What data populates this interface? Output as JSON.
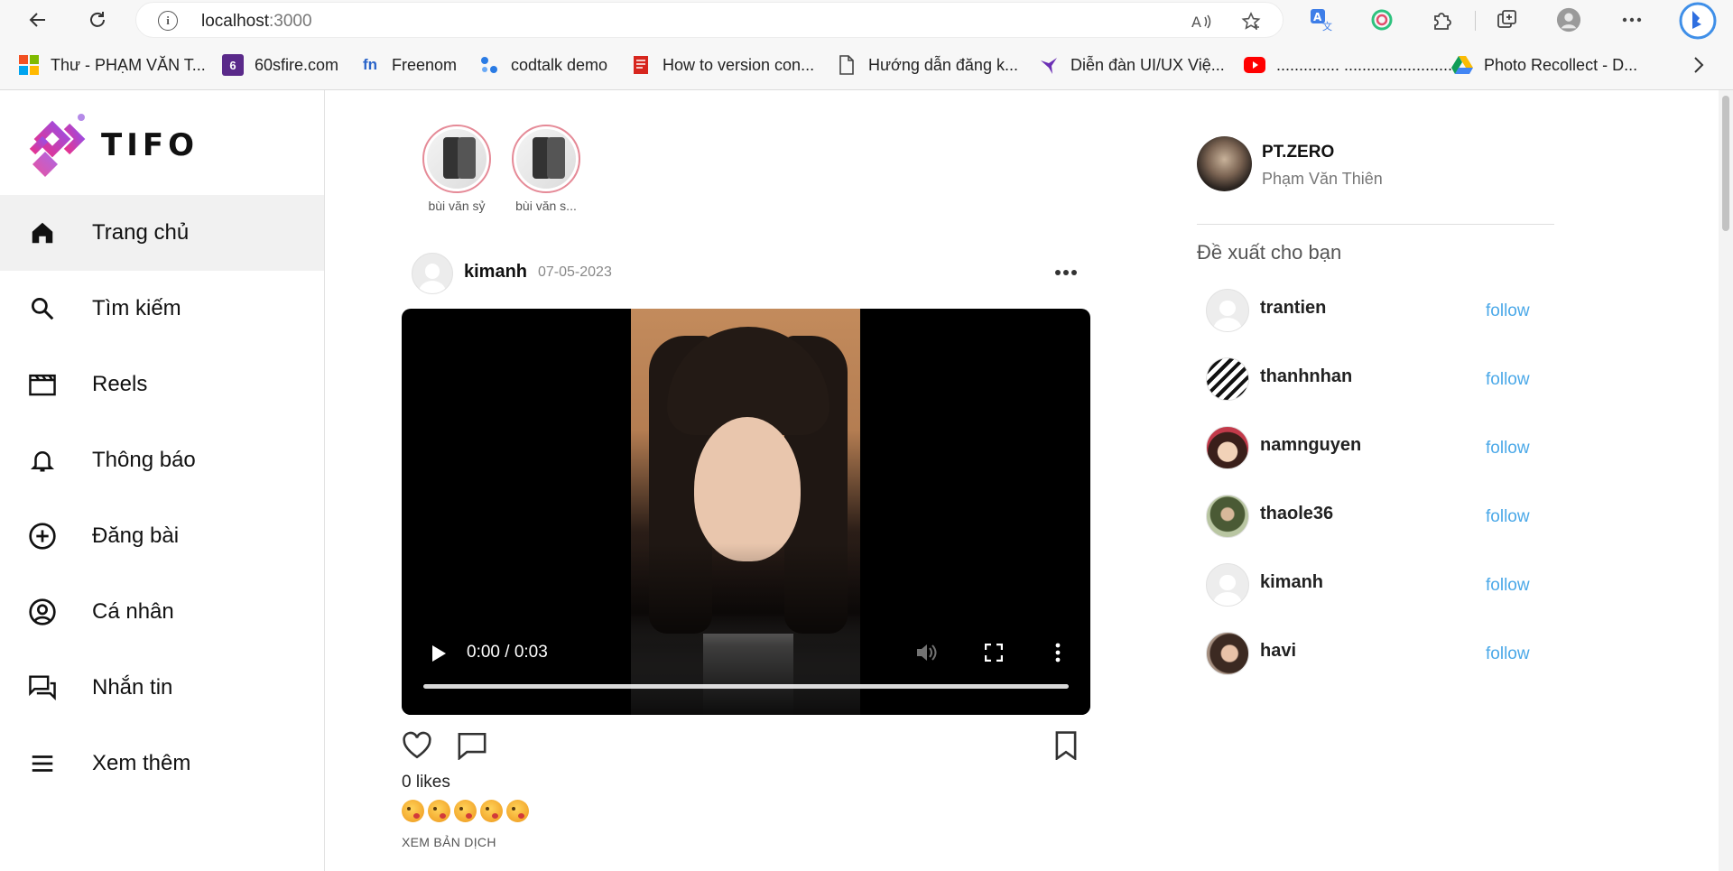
{
  "browser": {
    "url_host": "localhost",
    "url_port": ":3000",
    "bookmarks": [
      {
        "label": "Thư - PHẠM VĂN T...",
        "icon": "microsoft-icon"
      },
      {
        "label": "60sfire.com",
        "icon": "sixty-fire-icon"
      },
      {
        "label": "Freenom",
        "icon": "freenom-icon"
      },
      {
        "label": "codtalk demo",
        "icon": "codtalk-icon"
      },
      {
        "label": "How to version con...",
        "icon": "doc-red-icon"
      },
      {
        "label": "Hướng dẫn đăng k...",
        "icon": "page-icon"
      },
      {
        "label": "Diễn đàn UI/UX Việ...",
        "icon": "uiux-icon"
      },
      {
        "label": "..............  ............................",
        "icon": "youtube-icon"
      },
      {
        "label": "Photo Recollect - D...",
        "icon": "drive-icon"
      }
    ]
  },
  "sidebar": {
    "logo_text": "TIFO",
    "nav": [
      {
        "label": "Trang chủ",
        "icon": "home-icon",
        "active": true
      },
      {
        "label": "Tìm kiếm",
        "icon": "search-icon"
      },
      {
        "label": "Reels",
        "icon": "reels-icon"
      },
      {
        "label": "Thông báo",
        "icon": "bell-icon"
      },
      {
        "label": "Đăng bài",
        "icon": "add-circle-icon"
      },
      {
        "label": "Cá nhân",
        "icon": "profile-icon"
      },
      {
        "label": "Nhắn tin",
        "icon": "messages-icon"
      },
      {
        "label": "Xem thêm",
        "icon": "menu-icon"
      }
    ]
  },
  "stories": [
    {
      "name": "bùi văn sỷ"
    },
    {
      "name": "bùi văn s..."
    }
  ],
  "post": {
    "username": "kimanh",
    "date": "07-05-2023",
    "video": {
      "time": "0:00 / 0:03",
      "progress": 0
    },
    "likes": "0 likes",
    "emoji_count": 5,
    "translate": "XEM BẢN DỊCH"
  },
  "right_panel": {
    "me": {
      "username": "PT.ZERO",
      "full_name": "Phạm Văn Thiên"
    },
    "suggest_title": "Đề xuất cho bạn",
    "follow_label": "follow",
    "suggestions": [
      {
        "username": "trantien",
        "avatar": "placeholder"
      },
      {
        "username": "thanhnhan",
        "avatar": "manga"
      },
      {
        "username": "namnguyen",
        "avatar": "anime"
      },
      {
        "username": "thaole36",
        "avatar": "photo-green"
      },
      {
        "username": "kimanh",
        "avatar": "placeholder"
      },
      {
        "username": "havi",
        "avatar": "photo-warm"
      }
    ]
  },
  "colors": {
    "accent_follow": "#4aa8e8",
    "logo_gradient_start": "#e6338f",
    "logo_gradient_end": "#9b4de3",
    "active_nav_bg": "#f1f1f1"
  }
}
